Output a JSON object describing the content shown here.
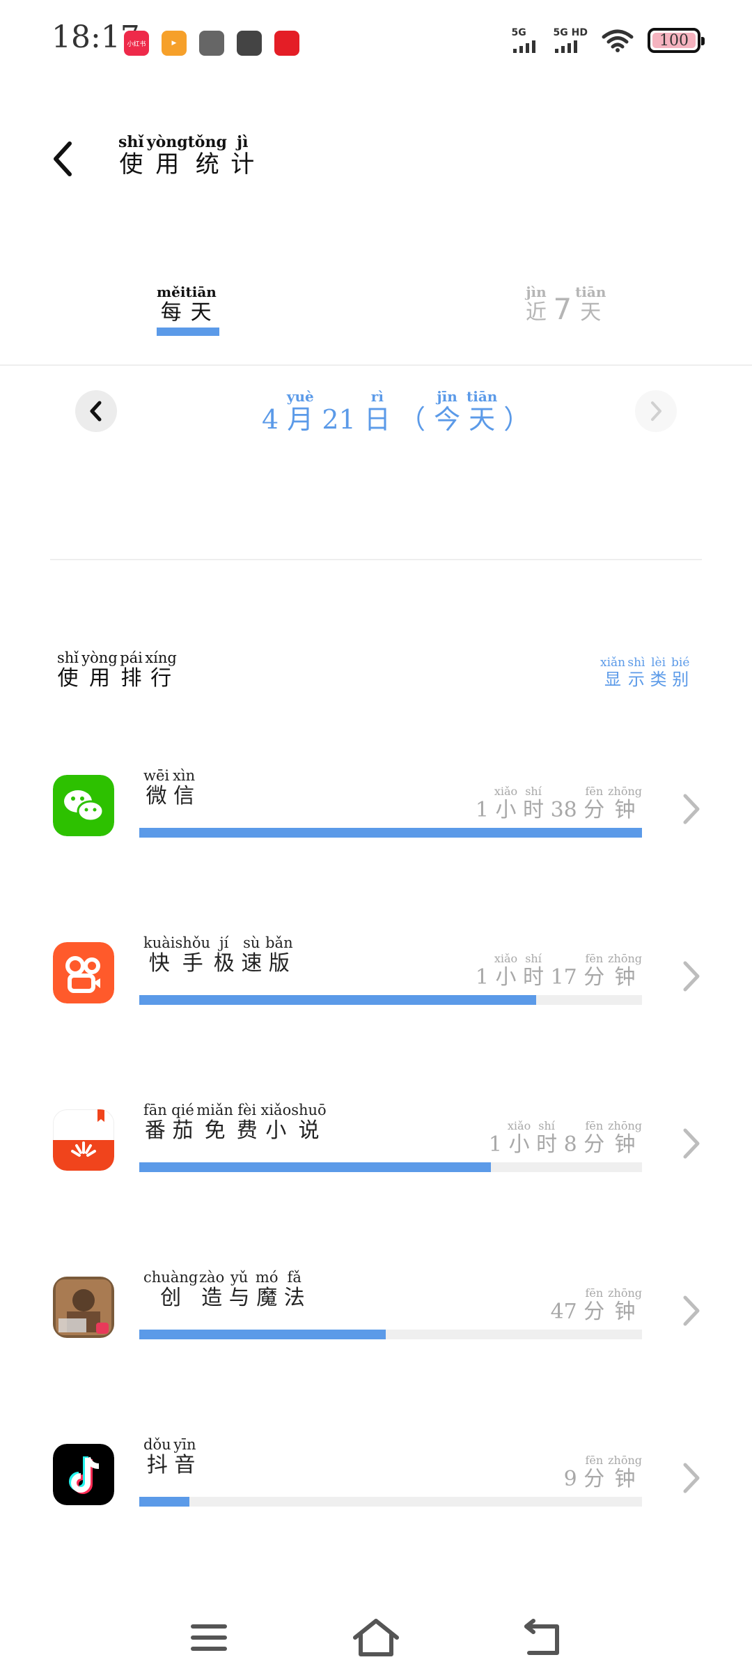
{
  "status_bar": {
    "time": "18:17",
    "notification_icons": [
      {
        "name": "xiaohongshu-icon",
        "color": "#ee2a4a",
        "text": "小红书"
      },
      {
        "name": "video-app-icon",
        "color": "#f6a02a",
        "text": "▶"
      },
      {
        "name": "game-controller-icon",
        "color": "#666666",
        "text": ""
      },
      {
        "name": "wechat-icon",
        "color": "#444444",
        "text": ""
      },
      {
        "name": "gift-icon",
        "color": "#e41e26",
        "text": ""
      }
    ],
    "signal_1_label": "5G",
    "signal_2_label": "5G HD",
    "battery_level": "100"
  },
  "header": {
    "title_chars": [
      {
        "c": "使",
        "p": "shǐ"
      },
      {
        "c": "用",
        "p": "yòng"
      },
      {
        "c": "统",
        "p": "tǒng"
      },
      {
        "c": "计",
        "p": "jì"
      }
    ]
  },
  "tabs": {
    "daily": [
      {
        "c": "每",
        "p": "měi"
      },
      {
        "c": "天",
        "p": "tiān"
      }
    ],
    "seven_days": [
      {
        "c": "近",
        "p": "jìn"
      },
      {
        "c": "7",
        "p": ""
      },
      {
        "c": "天",
        "p": "tiān"
      }
    ],
    "active": "daily"
  },
  "date_nav": {
    "date": [
      {
        "c": "4",
        "p": ""
      },
      {
        "c": "月",
        "p": "yuè"
      },
      {
        "c": "21",
        "p": ""
      },
      {
        "c": "日",
        "p": "rì"
      },
      {
        "c": "（",
        "p": ""
      },
      {
        "c": "今",
        "p": "jīn"
      },
      {
        "c": "天",
        "p": "tiān"
      },
      {
        "c": "）",
        "p": ""
      }
    ]
  },
  "ranking": {
    "title": [
      {
        "c": "使",
        "p": "shǐ"
      },
      {
        "c": "用",
        "p": "yòng"
      },
      {
        "c": "排",
        "p": "pái"
      },
      {
        "c": "行",
        "p": "xíng"
      }
    ],
    "show_category": [
      {
        "c": "显",
        "p": "xiǎn"
      },
      {
        "c": "示",
        "p": "shì"
      },
      {
        "c": "类",
        "p": "lèi"
      },
      {
        "c": "别",
        "p": "bié"
      }
    ]
  },
  "apps": [
    {
      "id": "wechat",
      "name": [
        {
          "c": "微",
          "p": "wēi"
        },
        {
          "c": "信",
          "p": "xìn"
        }
      ],
      "time": [
        {
          "c": "1",
          "p": ""
        },
        {
          "c": "小",
          "p": "xiǎo"
        },
        {
          "c": "时",
          "p": "shí"
        },
        {
          "c": "38",
          "p": ""
        },
        {
          "c": "分",
          "p": "fēn"
        },
        {
          "c": "钟",
          "p": "zhōng"
        }
      ],
      "usage_fraction": 1.0,
      "icon_color": "#2dc100"
    },
    {
      "id": "kuaishou",
      "name": [
        {
          "c": "快",
          "p": "kuài"
        },
        {
          "c": "手",
          "p": "shǒu"
        },
        {
          "c": "极",
          "p": "jí"
        },
        {
          "c": "速",
          "p": "sù"
        },
        {
          "c": "版",
          "p": "bǎn"
        }
      ],
      "time": [
        {
          "c": "1",
          "p": ""
        },
        {
          "c": "小",
          "p": "xiǎo"
        },
        {
          "c": "时",
          "p": "shí"
        },
        {
          "c": "17",
          "p": ""
        },
        {
          "c": "分",
          "p": "fēn"
        },
        {
          "c": "钟",
          "p": "zhōng"
        }
      ],
      "usage_fraction": 0.79,
      "icon_color": "#ff5a2b"
    },
    {
      "id": "fanqie",
      "name": [
        {
          "c": "番",
          "p": "fān"
        },
        {
          "c": "茄",
          "p": "qié"
        },
        {
          "c": "免",
          "p": "miǎn"
        },
        {
          "c": "费",
          "p": "fèi"
        },
        {
          "c": "小",
          "p": "xiǎo"
        },
        {
          "c": "说",
          "p": "shuō"
        }
      ],
      "time": [
        {
          "c": "1",
          "p": ""
        },
        {
          "c": "小",
          "p": "xiǎo"
        },
        {
          "c": "时",
          "p": "shí"
        },
        {
          "c": "8",
          "p": ""
        },
        {
          "c": "分",
          "p": "fēn"
        },
        {
          "c": "钟",
          "p": "zhōng"
        }
      ],
      "usage_fraction": 0.7,
      "icon_color": "#f0441c"
    },
    {
      "id": "chuangzao",
      "name": [
        {
          "c": "创",
          "p": "chuàng"
        },
        {
          "c": "造",
          "p": "zào"
        },
        {
          "c": "与",
          "p": "yǔ"
        },
        {
          "c": "魔",
          "p": "mó"
        },
        {
          "c": "法",
          "p": "fǎ"
        }
      ],
      "time": [
        {
          "c": "47",
          "p": ""
        },
        {
          "c": "分",
          "p": "fēn"
        },
        {
          "c": "钟",
          "p": "zhōng"
        }
      ],
      "usage_fraction": 0.49,
      "icon_color": "#7a5a3a"
    },
    {
      "id": "douyin",
      "name": [
        {
          "c": "抖",
          "p": "dǒu"
        },
        {
          "c": "音",
          "p": "yīn"
        }
      ],
      "time": [
        {
          "c": "9",
          "p": ""
        },
        {
          "c": "分",
          "p": "fēn"
        },
        {
          "c": "钟",
          "p": "zhōng"
        }
      ],
      "usage_fraction": 0.1,
      "icon_color": "#000000"
    }
  ],
  "colors": {
    "accent": "#5b9ae8",
    "track": "#efefef",
    "muted_text": "#a8a8a8"
  }
}
